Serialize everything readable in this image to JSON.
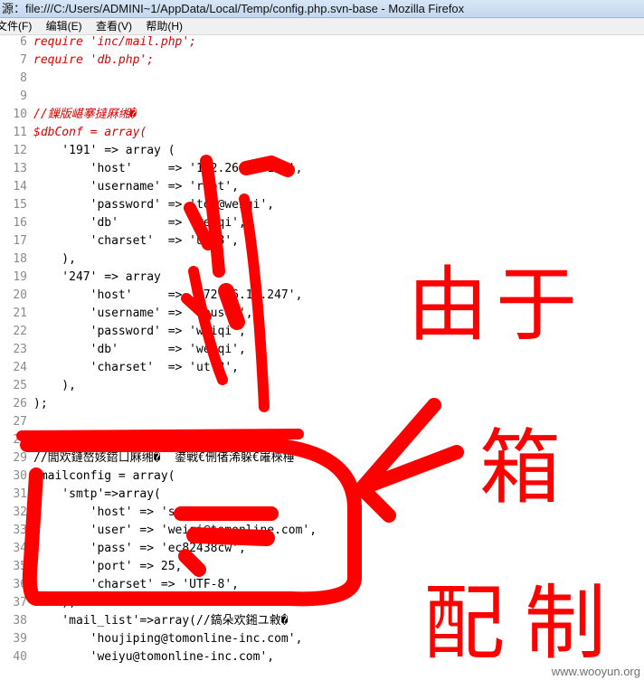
{
  "window": {
    "title": "源：file:///C:/Users/ADMINI~1/AppData/Local/Temp/config.php.svn-base - Mozilla Firefox"
  },
  "menu": [
    "文件(F)",
    "编辑(E)",
    "查看(V)",
    "帮助(H)"
  ],
  "code_lines": [
    {
      "num": "6",
      "text": "require 'inc/mail.php';",
      "style": "red"
    },
    {
      "num": "7",
      "text": "require 'db.php';",
      "style": "red"
    },
    {
      "num": "8",
      "text": "",
      "style": ""
    },
    {
      "num": "9",
      "text": "",
      "style": ""
    },
    {
      "num": "10",
      "text": "//鏁版嵁搴撻厤缃�",
      "style": "red"
    },
    {
      "num": "11",
      "text": "$dbConf = array(",
      "style": "red"
    },
    {
      "num": "12",
      "text": "    '191' => array (",
      "style": ""
    },
    {
      "num": "13",
      "text": "        'host'     => '172.26.11.191',",
      "style": ""
    },
    {
      "num": "14",
      "text": "        'username' => 'root',",
      "style": ""
    },
    {
      "num": "15",
      "text": "        'password' => 'tom@weiqi',",
      "style": ""
    },
    {
      "num": "16",
      "text": "        'db'       => 'weiqi',",
      "style": ""
    },
    {
      "num": "17",
      "text": "        'charset'  => 'utf8',",
      "style": ""
    },
    {
      "num": "18",
      "text": "    ),",
      "style": ""
    },
    {
      "num": "19",
      "text": "    '247' => array",
      "style": ""
    },
    {
      "num": "20",
      "text": "        'host'     => '172.26.11.247',",
      "style": ""
    },
    {
      "num": "21",
      "text": "        'username' => 'dbuser',",
      "style": ""
    },
    {
      "num": "22",
      "text": "        'password' => 'weiqi',",
      "style": ""
    },
    {
      "num": "23",
      "text": "        'db'       => 'weiqi',",
      "style": ""
    },
    {
      "num": "24",
      "text": "        'charset'  => 'utf8',",
      "style": ""
    },
    {
      "num": "25",
      "text": "    ),",
      "style": ""
    },
    {
      "num": "26",
      "text": ");",
      "style": ""
    },
    {
      "num": "27",
      "text": "",
      "style": ""
    },
    {
      "num": "28",
      "text": "",
      "style": ""
    },
    {
      "num": "29",
      "text": "//閭欢鏈嶅姟鍣ㄩ厤缃�  鍙戦€侀偖浠躲€嶉棶棰",
      "style": ""
    },
    {
      "num": "30",
      "text": "$mailconfig = array(",
      "style": ""
    },
    {
      "num": "31",
      "text": "    'smtp'=>array(",
      "style": ""
    },
    {
      "num": "32",
      "text": "        'host' => 'smtp.tom.net',",
      "style": ""
    },
    {
      "num": "33",
      "text": "        'user' => 'weiqi@tomonline.com',",
      "style": ""
    },
    {
      "num": "34",
      "text": "        'pass' => 'ec82438cw',",
      "style": ""
    },
    {
      "num": "35",
      "text": "        'port' => 25,",
      "style": ""
    },
    {
      "num": "36",
      "text": "        'charset' => 'UTF-8',",
      "style": ""
    },
    {
      "num": "37",
      "text": "    ),",
      "style": ""
    },
    {
      "num": "38",
      "text": "    'mail_list'=>array(//鎬朵欢鎺ユ敹�",
      "style": ""
    },
    {
      "num": "39",
      "text": "        'houjiping@tomonline-inc.com',",
      "style": ""
    },
    {
      "num": "40",
      "text": "        'weiyu@tomonline-inc.com',",
      "style": ""
    }
  ],
  "annotation": {
    "chars": [
      "由",
      "于",
      "箱",
      "配",
      "制"
    ]
  },
  "watermark": "www.wooyun.org"
}
